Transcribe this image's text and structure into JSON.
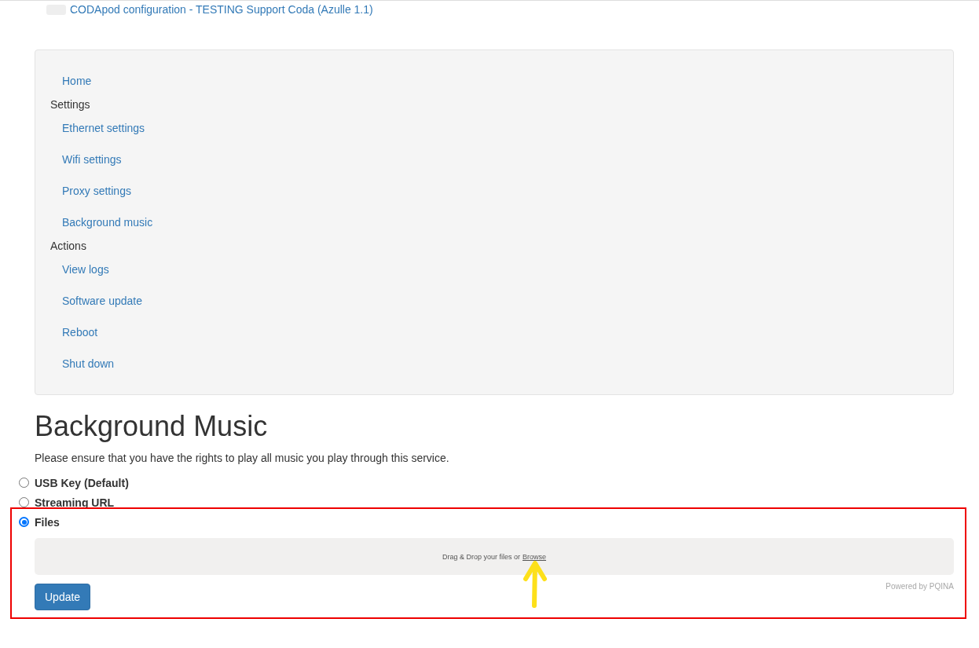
{
  "header": {
    "title": "CODApod configuration - TESTING Support Coda (Azulle 1.1)"
  },
  "nav": [
    {
      "kind": "link",
      "label": "Home"
    },
    {
      "kind": "header",
      "label": "Settings"
    },
    {
      "kind": "link",
      "label": "Ethernet settings"
    },
    {
      "kind": "link",
      "label": "Wifi settings"
    },
    {
      "kind": "link",
      "label": "Proxy settings"
    },
    {
      "kind": "link",
      "label": "Background music"
    },
    {
      "kind": "header",
      "label": "Actions"
    },
    {
      "kind": "link",
      "label": "View logs"
    },
    {
      "kind": "link",
      "label": "Software update"
    },
    {
      "kind": "link",
      "label": "Reboot"
    },
    {
      "kind": "link",
      "label": "Shut down"
    }
  ],
  "heading": "Background Music",
  "notice": "Please ensure that you have the rights to play all music you play through this service.",
  "sources": [
    {
      "label": "USB Key (Default)",
      "selected": false
    },
    {
      "label": "Streaming URL",
      "selected": false
    },
    {
      "label": "Files",
      "selected": true
    }
  ],
  "dropzone": {
    "text": "Drag & Drop your files or",
    "link": "Browse",
    "credit": "Powered by PQINA"
  },
  "button": "Update"
}
